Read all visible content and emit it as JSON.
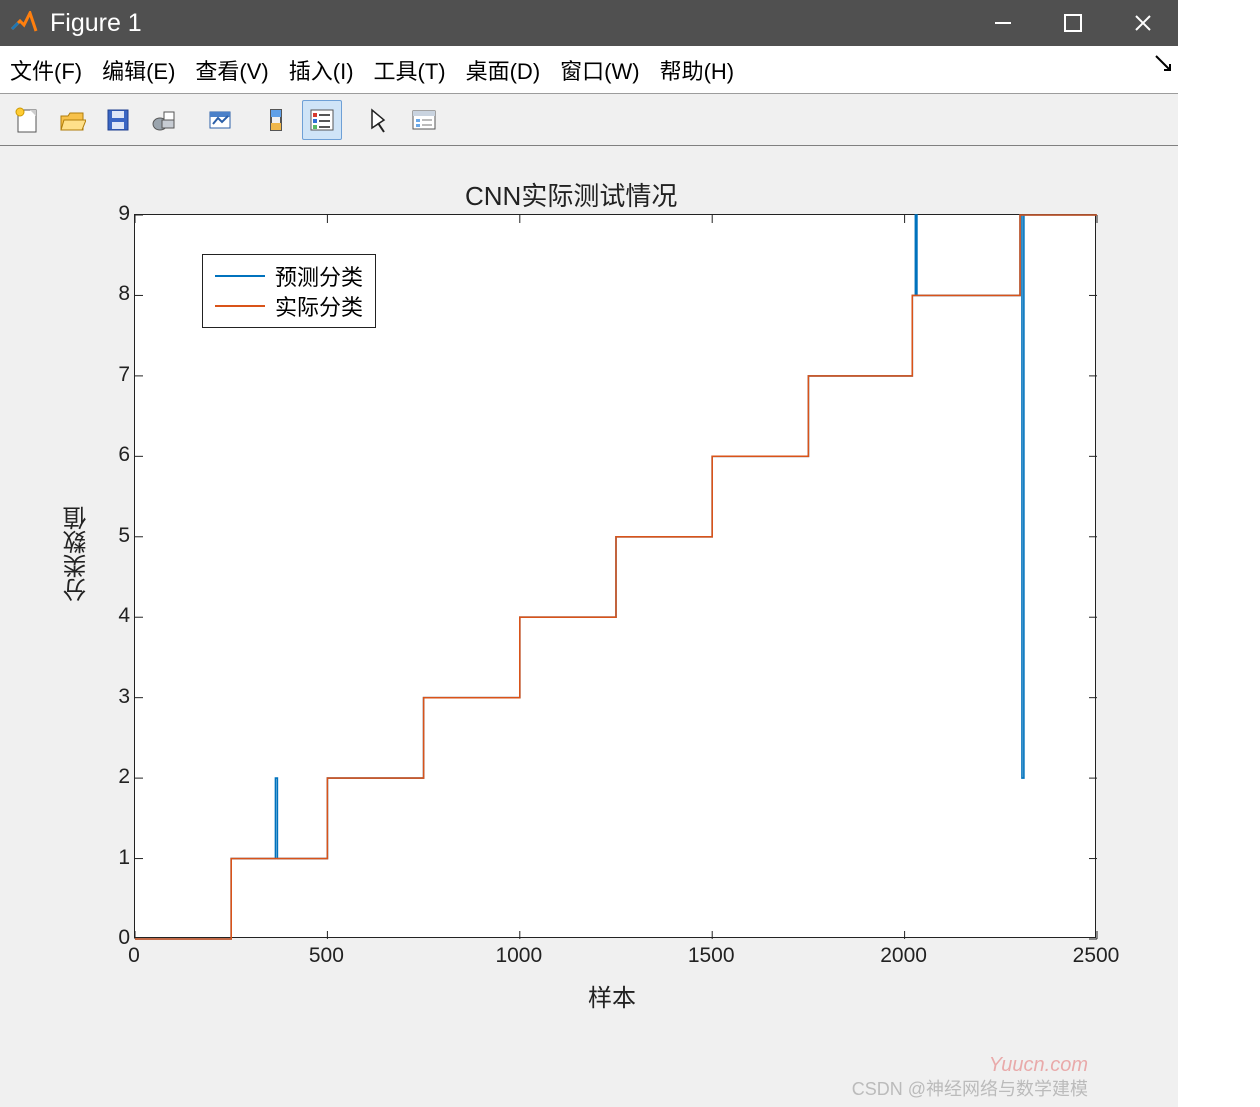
{
  "window": {
    "title": "Figure 1"
  },
  "menu": {
    "items": [
      "文件(F)",
      "编辑(E)",
      "查看(V)",
      "插入(I)",
      "工具(T)",
      "桌面(D)",
      "窗口(W)",
      "帮助(H)"
    ]
  },
  "toolbar": {
    "icons": [
      "new-figure-icon",
      "open-icon",
      "save-icon",
      "print-icon",
      "link-axes-icon",
      "rotate-icon",
      "legend-toggle-icon",
      "edit-plot-icon",
      "colorbar-icon"
    ],
    "active_index": 6
  },
  "watermarks": {
    "csdn": "CSDN @神经网络与数学建模",
    "site": "Yuucn.com"
  },
  "legend": {
    "series1": "预测分类",
    "series2": "实际分类"
  },
  "chart_data": {
    "type": "line",
    "title": "CNN实际测试情况",
    "xlabel": "样本",
    "ylabel": "分类数值",
    "xlim": [
      0,
      2500
    ],
    "ylim": [
      0,
      9
    ],
    "xticks": [
      0,
      500,
      1000,
      1500,
      2000,
      2500
    ],
    "yticks": [
      0,
      1,
      2,
      3,
      4,
      5,
      6,
      7,
      8,
      9
    ],
    "colors": {
      "predicted": "#0072BD",
      "actual": "#D95319"
    },
    "legend_position": "upper-left",
    "series": [
      {
        "name": "实际分类",
        "type": "step",
        "x": [
          0,
          250,
          250,
          500,
          500,
          750,
          750,
          1000,
          1000,
          1250,
          1250,
          1500,
          1500,
          1750,
          1750,
          2020,
          2020,
          2300,
          2300,
          2500
        ],
        "values": [
          0,
          0,
          1,
          1,
          2,
          2,
          3,
          3,
          4,
          4,
          5,
          5,
          6,
          6,
          7,
          7,
          8,
          8,
          9,
          9
        ]
      },
      {
        "name": "预测分类",
        "type": "step",
        "x": [
          0,
          250,
          250,
          365,
          365,
          370,
          370,
          500,
          500,
          750,
          750,
          1000,
          1000,
          1250,
          1250,
          1500,
          1500,
          1750,
          1750,
          2020,
          2020,
          2028,
          2028,
          2032,
          2032,
          2300,
          2300,
          2305,
          2305,
          2310,
          2310,
          2500
        ],
        "values": [
          0,
          0,
          1,
          1,
          2,
          2,
          1,
          1,
          2,
          2,
          3,
          3,
          4,
          4,
          5,
          5,
          6,
          6,
          7,
          7,
          8,
          8,
          9,
          9,
          8,
          8,
          9,
          9,
          2,
          2,
          9,
          9
        ]
      }
    ]
  }
}
